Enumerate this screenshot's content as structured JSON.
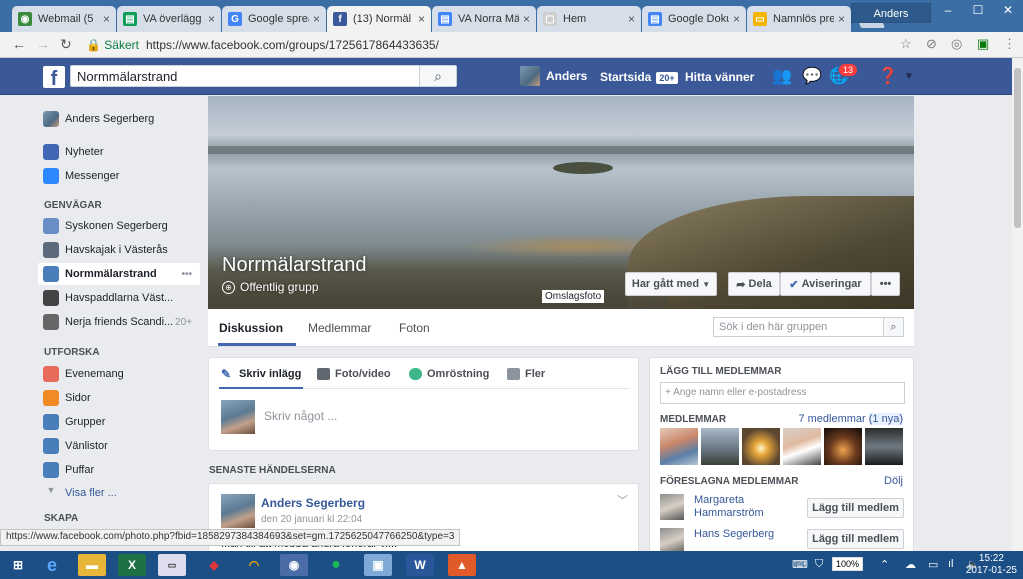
{
  "browser": {
    "tabs": [
      {
        "title": "Webmail (5",
        "color": "#3b8a3e",
        "glyph": "◉"
      },
      {
        "title": "VA överlägg",
        "color": "#0f9d58",
        "glyph": "▤"
      },
      {
        "title": "Google sprea",
        "color": "#4285f4",
        "glyph": "G"
      },
      {
        "title": "(13) Normäl",
        "color": "#3b5998",
        "glyph": "f"
      },
      {
        "title": "VA Norra Mä",
        "color": "#4285f4",
        "glyph": "▤"
      },
      {
        "title": "Hem",
        "color": "#cfcfcf",
        "glyph": "▢"
      },
      {
        "title": "Google Doku",
        "color": "#4285f4",
        "glyph": "▤"
      },
      {
        "title": "Namnlös pre",
        "color": "#f4b400",
        "glyph": "▭"
      }
    ],
    "profile": "Anders",
    "secure_label": "Säkert",
    "url": "https://www.facebook.com/groups/1725617864433635/",
    "status_url": "https://www.facebook.com/photo.php?fbid=1858297384384693&set=gm.1725625047766250&type=3"
  },
  "fb": {
    "logo": "f",
    "search_value": "Normmälarstrand",
    "user_name": "Anders",
    "home_label": "Startsida",
    "home_badge": "20+",
    "find_friends": "Hitta vänner",
    "notif_count": "13"
  },
  "sidebar": {
    "profile_name": "Anders Segerberg",
    "items": [
      {
        "label": "Nyheter",
        "color": "#4267b2"
      },
      {
        "label": "Messenger",
        "color": "#2d88ff"
      }
    ],
    "shortcuts_header": "GENVÄGAR",
    "shortcuts": [
      {
        "label": "Syskonen Segerberg",
        "color": "#6a8fc7",
        "count": ""
      },
      {
        "label": "Havskajak i Västerås",
        "color": "#5b6b7b",
        "count": ""
      },
      {
        "label": "Normmälarstrand",
        "color": "#4a7ebb",
        "count": "•••"
      },
      {
        "label": "Havspaddlarna Väst...",
        "color": "#444",
        "count": ""
      },
      {
        "label": "Nerja friends Scandi...",
        "color": "#666",
        "count": "20+"
      }
    ],
    "explore_header": "UTFORSKA",
    "explore": [
      {
        "label": "Evenemang",
        "color": "#e86a5a"
      },
      {
        "label": "Sidor",
        "color": "#f08a24"
      },
      {
        "label": "Grupper",
        "color": "#4a7ebb"
      },
      {
        "label": "Vänlistor",
        "color": "#4a7ebb"
      },
      {
        "label": "Puffar",
        "color": "#4a7ebb"
      }
    ],
    "see_more": "Visa fler ...",
    "create_header": "SKAPA"
  },
  "group": {
    "name": "Norrmälarstrand",
    "type": "Offentlig grupp",
    "cover_label": "Omslagsfoto",
    "joined_button": "Har gått med",
    "share_button": "Dela",
    "notifications_button": "Aviseringar",
    "more_button": "•••",
    "tabs": [
      "Diskussion",
      "Medlemmar",
      "Foton"
    ],
    "search_placeholder": "Sök i den här gruppen"
  },
  "composer": {
    "tabs": [
      "Skriv inlägg",
      "Foto/video",
      "Omröstning",
      "Fler"
    ],
    "placeholder": "Skriv något ..."
  },
  "feed": {
    "header": "SENASTE HÄNDELSERNA",
    "post": {
      "author": "Anders Segerberg",
      "date": "den 20 januari kl 22:04",
      "text": "...an till att mobba andra förlorar vi..."
    }
  },
  "members": {
    "add_header": "LÄGG TILL MEDLEMMAR",
    "add_placeholder": "+ Ange namn eller e-postadress",
    "members_header": "MEDLEMMAR",
    "count_label": "7 medlemmar",
    "new_label": "(1 nya)",
    "suggested_header": "FÖRESLAGNA MEDLEMMAR",
    "hide_label": "Dölj",
    "add_member_label": "Lägg till medlem",
    "suggested": [
      {
        "name": "Margareta Hammarström"
      },
      {
        "name": "Hans Segerberg"
      }
    ]
  },
  "taskbar": {
    "battery": "100%",
    "time": "15:22",
    "date": "2017-01-25"
  }
}
